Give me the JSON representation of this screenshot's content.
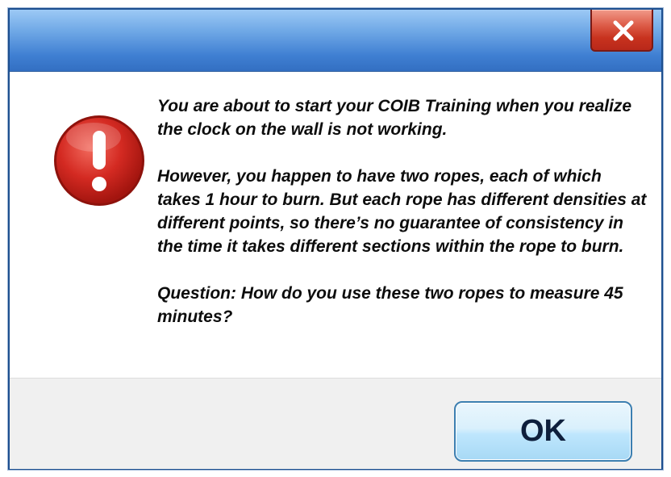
{
  "dialog": {
    "close_icon": "close-x-icon",
    "alert_icon": "exclamation-error-icon",
    "message_paragraphs": [
      "You are about to start your COIB Training when you realize the clock on the wall is not working.",
      "However, you happen to have two ropes, each of which takes 1 hour to burn. But each rope has different densities at different points, so there’s no guarantee of consistency in the time it takes different sections within the rope to burn.",
      "Question: How do you use these two ropes to measure 45 minutes?"
    ],
    "ok_label": "OK"
  },
  "colors": {
    "titlebar": "#4a88d8",
    "close_button": "#c8321e",
    "alert_red": "#d42a22",
    "ok_button": "#bee6fd",
    "footer": "#f0f0f0"
  }
}
